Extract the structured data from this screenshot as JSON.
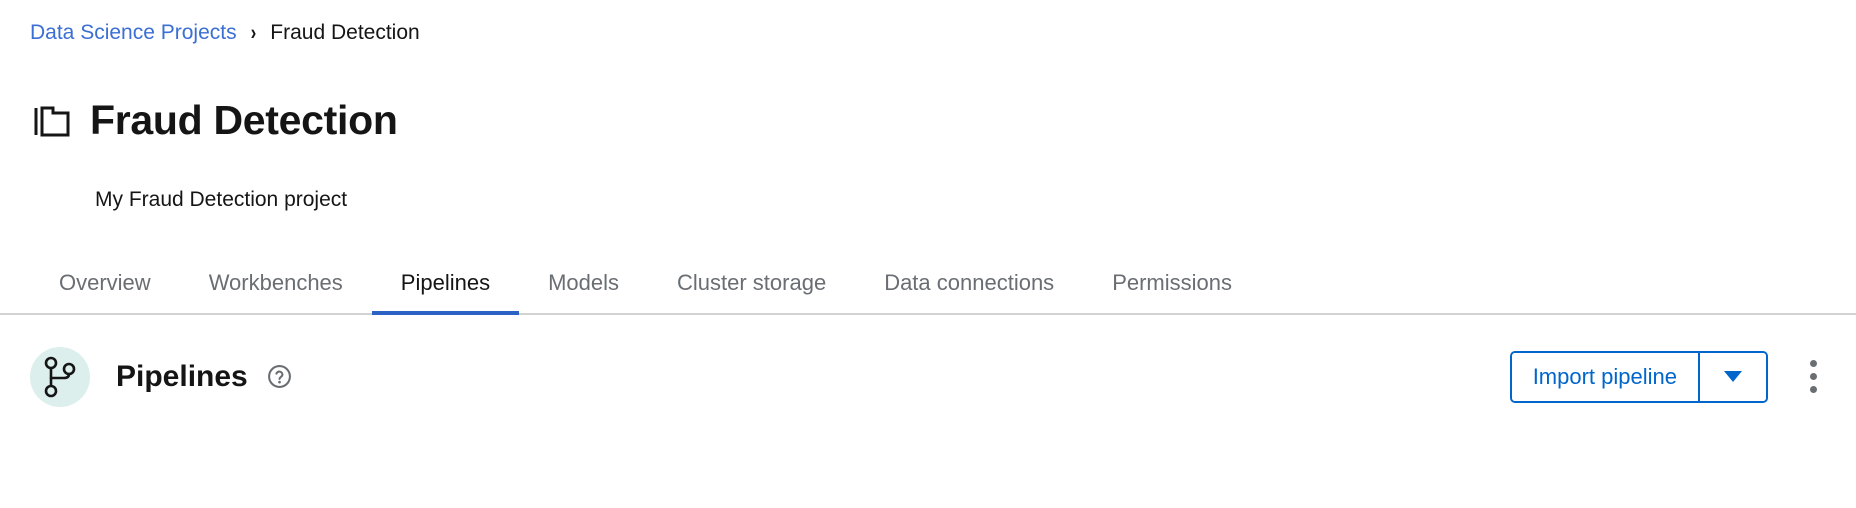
{
  "breadcrumb": {
    "parent_label": "Data Science Projects",
    "separator": "›",
    "current_label": "Fraud Detection"
  },
  "header": {
    "icon": "folder-icon",
    "title": "Fraud Detection",
    "description": "My Fraud Detection project"
  },
  "tabs": {
    "items": [
      {
        "label": "Overview",
        "active": false
      },
      {
        "label": "Workbenches",
        "active": false
      },
      {
        "label": "Pipelines",
        "active": true
      },
      {
        "label": "Models",
        "active": false
      },
      {
        "label": "Cluster storage",
        "active": false
      },
      {
        "label": "Data connections",
        "active": false
      },
      {
        "label": "Permissions",
        "active": false
      }
    ]
  },
  "section": {
    "icon": "pipeline-branch-icon",
    "title": "Pipelines",
    "help_icon": "help-circle-icon",
    "import_label": "Import pipeline",
    "toggle_icon": "chevron-down-icon",
    "kebab_icon": "kebab-menu-icon"
  },
  "colors": {
    "link_blue": "#3b6fd4",
    "accent_blue": "#0066cc",
    "active_tab_underline": "#2b62c4",
    "avatar_mint": "#dcefed",
    "muted_gray": "#6a6e73",
    "border_gray": "#d2d2d2",
    "text_dark": "#151515"
  }
}
